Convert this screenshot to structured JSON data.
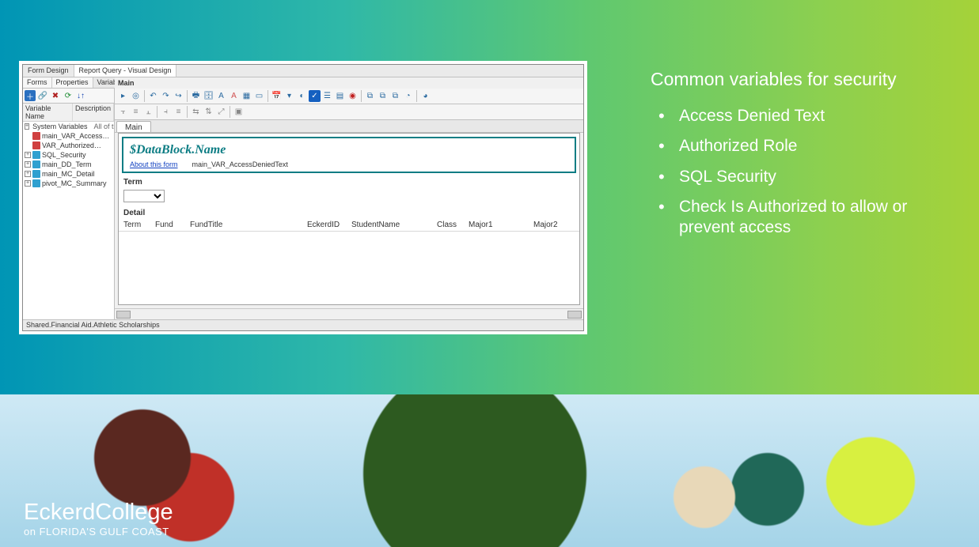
{
  "text": {
    "heading": "Common variables for security",
    "bullets": [
      "Access Denied Text",
      "Authorized Role",
      "SQL Security",
      "Check Is Authorized to allow or prevent access"
    ]
  },
  "logo": {
    "line1": "EckerdCollege",
    "line2": "on FLORIDA'S GULF COAST"
  },
  "shot": {
    "topTabs": [
      "Form Design",
      "Report Query - Visual Design"
    ],
    "leftTabs": [
      "Forms",
      "Properties",
      "Variables"
    ],
    "mainLabel": "Main",
    "canvasTabs": [
      "Main"
    ],
    "status": "Shared.Financial Aid.Athletic Scholarships",
    "tree": {
      "cols": [
        "Variable Name",
        "Description"
      ],
      "rows": [
        {
          "label": "System Variables",
          "desc": "All of the s"
        },
        {
          "label": "main_VAR_Access…"
        },
        {
          "label": "VAR_Authorized…"
        },
        {
          "label": "SQL_Security"
        },
        {
          "label": "main_DD_Term"
        },
        {
          "label": "main_MC_Detail"
        },
        {
          "label": "pivot_MC_Summary"
        }
      ]
    },
    "block": {
      "title": "$DataBlock.Name",
      "aboutLink": "About this form",
      "varRef": "main_VAR_AccessDeniedText"
    },
    "sections": {
      "term": "Term",
      "detail": "Detail"
    },
    "grid": {
      "cols": [
        "Term",
        "Fund",
        "FundTitle",
        "EckerdID",
        "StudentName",
        "Class",
        "Major1",
        "Major2"
      ]
    }
  }
}
